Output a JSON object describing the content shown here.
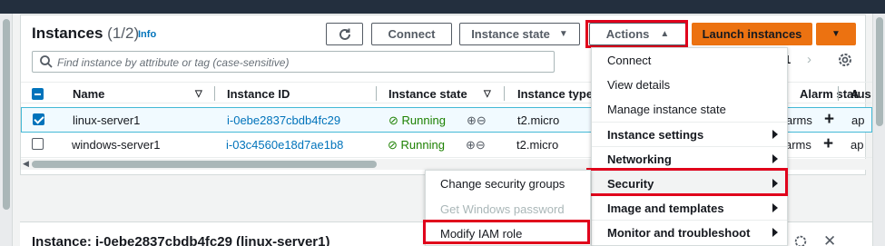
{
  "header": {
    "title": "Instances",
    "count": "(1/2)",
    "info": "Info"
  },
  "toolbar": {
    "connect": "Connect",
    "instance_state": "Instance state",
    "actions": "Actions",
    "launch": "Launch instances"
  },
  "search": {
    "placeholder": "Find instance by attribute or tag (case-sensitive)"
  },
  "pagination": {
    "page": "1"
  },
  "table": {
    "columns": [
      "Name",
      "Instance ID",
      "Instance state",
      "Instance type",
      "Alarm status",
      "A"
    ],
    "rows": [
      {
        "name": "linux-server1",
        "id": "i-0ebe2837cbdb4fc29",
        "state": "Running",
        "type": "t2.micro",
        "alarm": "arms",
        "az": "ap",
        "selected": true
      },
      {
        "name": "windows-server1",
        "id": "i-03c4560e18d7ae1b8",
        "state": "Running",
        "type": "t2.micro",
        "alarm": "arms",
        "az": "ap",
        "selected": false
      }
    ]
  },
  "actions_menu": {
    "items": [
      {
        "label": "Connect",
        "bold": false,
        "submenu": false
      },
      {
        "label": "View details",
        "bold": false,
        "submenu": false
      },
      {
        "label": "Manage instance state",
        "bold": false,
        "submenu": false
      },
      {
        "label": "Instance settings",
        "bold": true,
        "submenu": true
      },
      {
        "label": "Networking",
        "bold": true,
        "submenu": true
      },
      {
        "label": "Security",
        "bold": true,
        "submenu": true
      },
      {
        "label": "Image and templates",
        "bold": true,
        "submenu": true
      },
      {
        "label": "Monitor and troubleshoot",
        "bold": true,
        "submenu": true
      }
    ]
  },
  "security_submenu": {
    "items": [
      {
        "label": "Change security groups",
        "disabled": false
      },
      {
        "label": "Get Windows password",
        "disabled": true
      },
      {
        "label": "Modify IAM role",
        "disabled": false
      }
    ]
  },
  "details": {
    "title": "Instance: i-0ebe2837cbdb4fc29 (linux-server1)"
  },
  "colors": {
    "accent": "#0073bb",
    "launch": "#ec7211",
    "running": "#1d8102",
    "highlight": "#e0001b"
  }
}
